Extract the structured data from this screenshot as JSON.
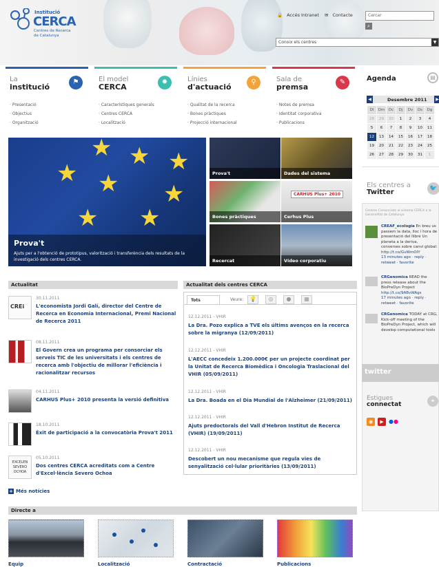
{
  "header": {
    "logo_line1": "Institució",
    "logo_line2": "CERCA",
    "logo_line3": "Centres de Recerca",
    "logo_line4": "de Catalunya",
    "intranet_label": "Accés Intranet",
    "contact_label": "Contacte",
    "search_placeholder": "Cercar",
    "centres_select": "Conoix els centres"
  },
  "nav": [
    {
      "t1": "La",
      "t2": "institució",
      "color": "#2a63b0",
      "items": [
        "Presentació",
        "Objectius",
        "Organització"
      ]
    },
    {
      "t1": "El model",
      "t2": "CERCA",
      "color": "#3bbfb1",
      "items": [
        "Característiques generals",
        "Centres CERCA",
        "Localització"
      ]
    },
    {
      "t1": "Línies",
      "t2": "d'actuació",
      "color": "#f2a33a",
      "items": [
        "Qualitat de la recerca",
        "Bones pràctiques",
        "Projecció internacional"
      ]
    },
    {
      "t1": "Sala de",
      "t2": "premsa",
      "color": "#d9384a",
      "items": [
        "Notes de premsa",
        "Identitat corporativa",
        "Publicacions"
      ]
    }
  ],
  "feature": {
    "title": "Prova't",
    "desc": "Ajuts per a l'obtenció de prototipus, valorització i transferència dels resultats de la investigació dels centres CERCA."
  },
  "thumbs": [
    "Prova't",
    "Dades del sistema",
    "Bones pràctiques",
    "Cerhus Plus",
    "Recercat",
    "Vídeo corporatiu"
  ],
  "thumb_overlay": "CARHUS Plus+ 2010",
  "actualitat": {
    "heading": "Actualitat",
    "items": [
      {
        "img": "CREi",
        "date": "30.11.2011",
        "text": "L'economista Jordi Galí, director del Centre de Recerca en Economia Internacional, Premi Nacional de Recerca 2011"
      },
      {
        "img": "",
        "date": "08.11.2011",
        "text": "El Govern crea un programa per consorciar els serveis TIC de les universitats i els centres de recerca amb l'objectiu de millorar l'eficiència i racionalitzar recursos"
      },
      {
        "img": "",
        "date": "04.11.2011",
        "text": "CARHUS Plus+ 2010 presenta la versió definitiva"
      },
      {
        "img": "",
        "date": "18.10.2011",
        "text": "Èxit de participació a la convocatòria Prova't 2011"
      },
      {
        "img": "EXCELEN SEVERO OCHOA",
        "date": "05.10.2011",
        "text": "Dos centres CERCA acreditats com a Centre d'Excel·lència Severo Ochoa"
      }
    ],
    "more": "Més notícies"
  },
  "centres_news": {
    "heading": "Actualitat dels centres CERCA",
    "tab_all": "Tots",
    "tab_view": "Veure:",
    "items": [
      {
        "date": "12.12.2011 - VHIR",
        "text": "La Dra. Pozo explica a TVE els últims avenços en la recerca sobre la migranya (12/09/2011)"
      },
      {
        "date": "12.12.2011 - VHIR",
        "text": "L'AECC concedeix 1.200.000€ per un projecte coordinat per la Unitat de Recerca Biomèdica i Oncologia Traslacional del VHIR (05/09/2011)"
      },
      {
        "date": "12.12.2011 - VHIR",
        "text": "La Dra. Boada en el Dia Mundial de l'Alzheimer (21/09/2011)"
      },
      {
        "date": "12.12.2011 - VHIR",
        "text": "Ajuts predoctorals del Vall d'Hebron Institut de Recerca (VHIR) (19/09/2011)"
      },
      {
        "date": "12.12.2011 - VHIR",
        "text": "Descobert un nou mecanisme que regula vies de senyalització cel·lular prioritàries (13/09/2011)"
      }
    ]
  },
  "directe": {
    "heading": "Directe a",
    "items": [
      "Equip",
      "Localització",
      "Contractació",
      "Publicacions"
    ]
  },
  "agenda": {
    "title": "Agenda",
    "month": "Desembre 2011",
    "days": [
      "Dl",
      "Dm",
      "Dc",
      "Dj",
      "Dv",
      "Ds",
      "Dg"
    ],
    "weeks": [
      [
        "28",
        "29",
        "30",
        "1",
        "2",
        "3",
        "4"
      ],
      [
        "5",
        "6",
        "7",
        "8",
        "9",
        "10",
        "11"
      ],
      [
        "12",
        "13",
        "14",
        "15",
        "16",
        "17",
        "18"
      ],
      [
        "19",
        "20",
        "21",
        "22",
        "23",
        "24",
        "25"
      ],
      [
        "26",
        "27",
        "28",
        "29",
        "30",
        "31",
        "1"
      ]
    ],
    "today": "12"
  },
  "twitter": {
    "title1": "Els centres a",
    "title2": "Twitter",
    "subtitle": "Centres Consorciats al sistema CERCA a la Generalitat de Catalunya",
    "tweets": [
      {
        "user": "CREAF_ecologia",
        "text": "En breu us passem la data, lloc i hora de presentació del llibre Un planeta a la deriva, converses sobre canvi global:",
        "link": "http://t.co/GvWmOIY",
        "meta": "13 minutes ago · reply · retweet · favorite"
      },
      {
        "user": "CRGenomica",
        "text": "READ the press release about the BioPreDyn Project",
        "link": "http://t.co/9ABvWAgs",
        "meta": "17 minutes ago · reply · retweet · favorite"
      },
      {
        "user": "CRGenomica",
        "text": "TODAY at CRG, Kick-off meeting of the BioPreDyn Project, which will develop computational tools to analyse data arising in"
      }
    ],
    "footer": "twitter"
  },
  "estigues": {
    "title1": "Estigues",
    "title2": "connectat"
  }
}
